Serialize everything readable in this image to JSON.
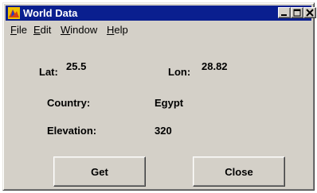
{
  "window": {
    "title": "World Data"
  },
  "menu": [
    {
      "prefix": "",
      "mnemonic": "F",
      "rest": "ile"
    },
    {
      "prefix": "",
      "mnemonic": "E",
      "rest": "dit"
    },
    {
      "prefix": "",
      "mnemonic": "W",
      "rest": "indow"
    },
    {
      "prefix": "",
      "mnemonic": "H",
      "rest": "elp"
    }
  ],
  "fields": {
    "lat": {
      "label": "Lat:",
      "value": "25.5"
    },
    "lon": {
      "label": "Lon:",
      "value": "28.82"
    },
    "country": {
      "label": "Country:",
      "value": "Egypt"
    },
    "elevation": {
      "label": "Elevation:",
      "value": "320"
    }
  },
  "buttons": {
    "get": "Get",
    "close": "Close"
  },
  "colors": {
    "titlebar": "#0a1f8f",
    "face": "#d4d0c8",
    "icon": "#d84010"
  }
}
